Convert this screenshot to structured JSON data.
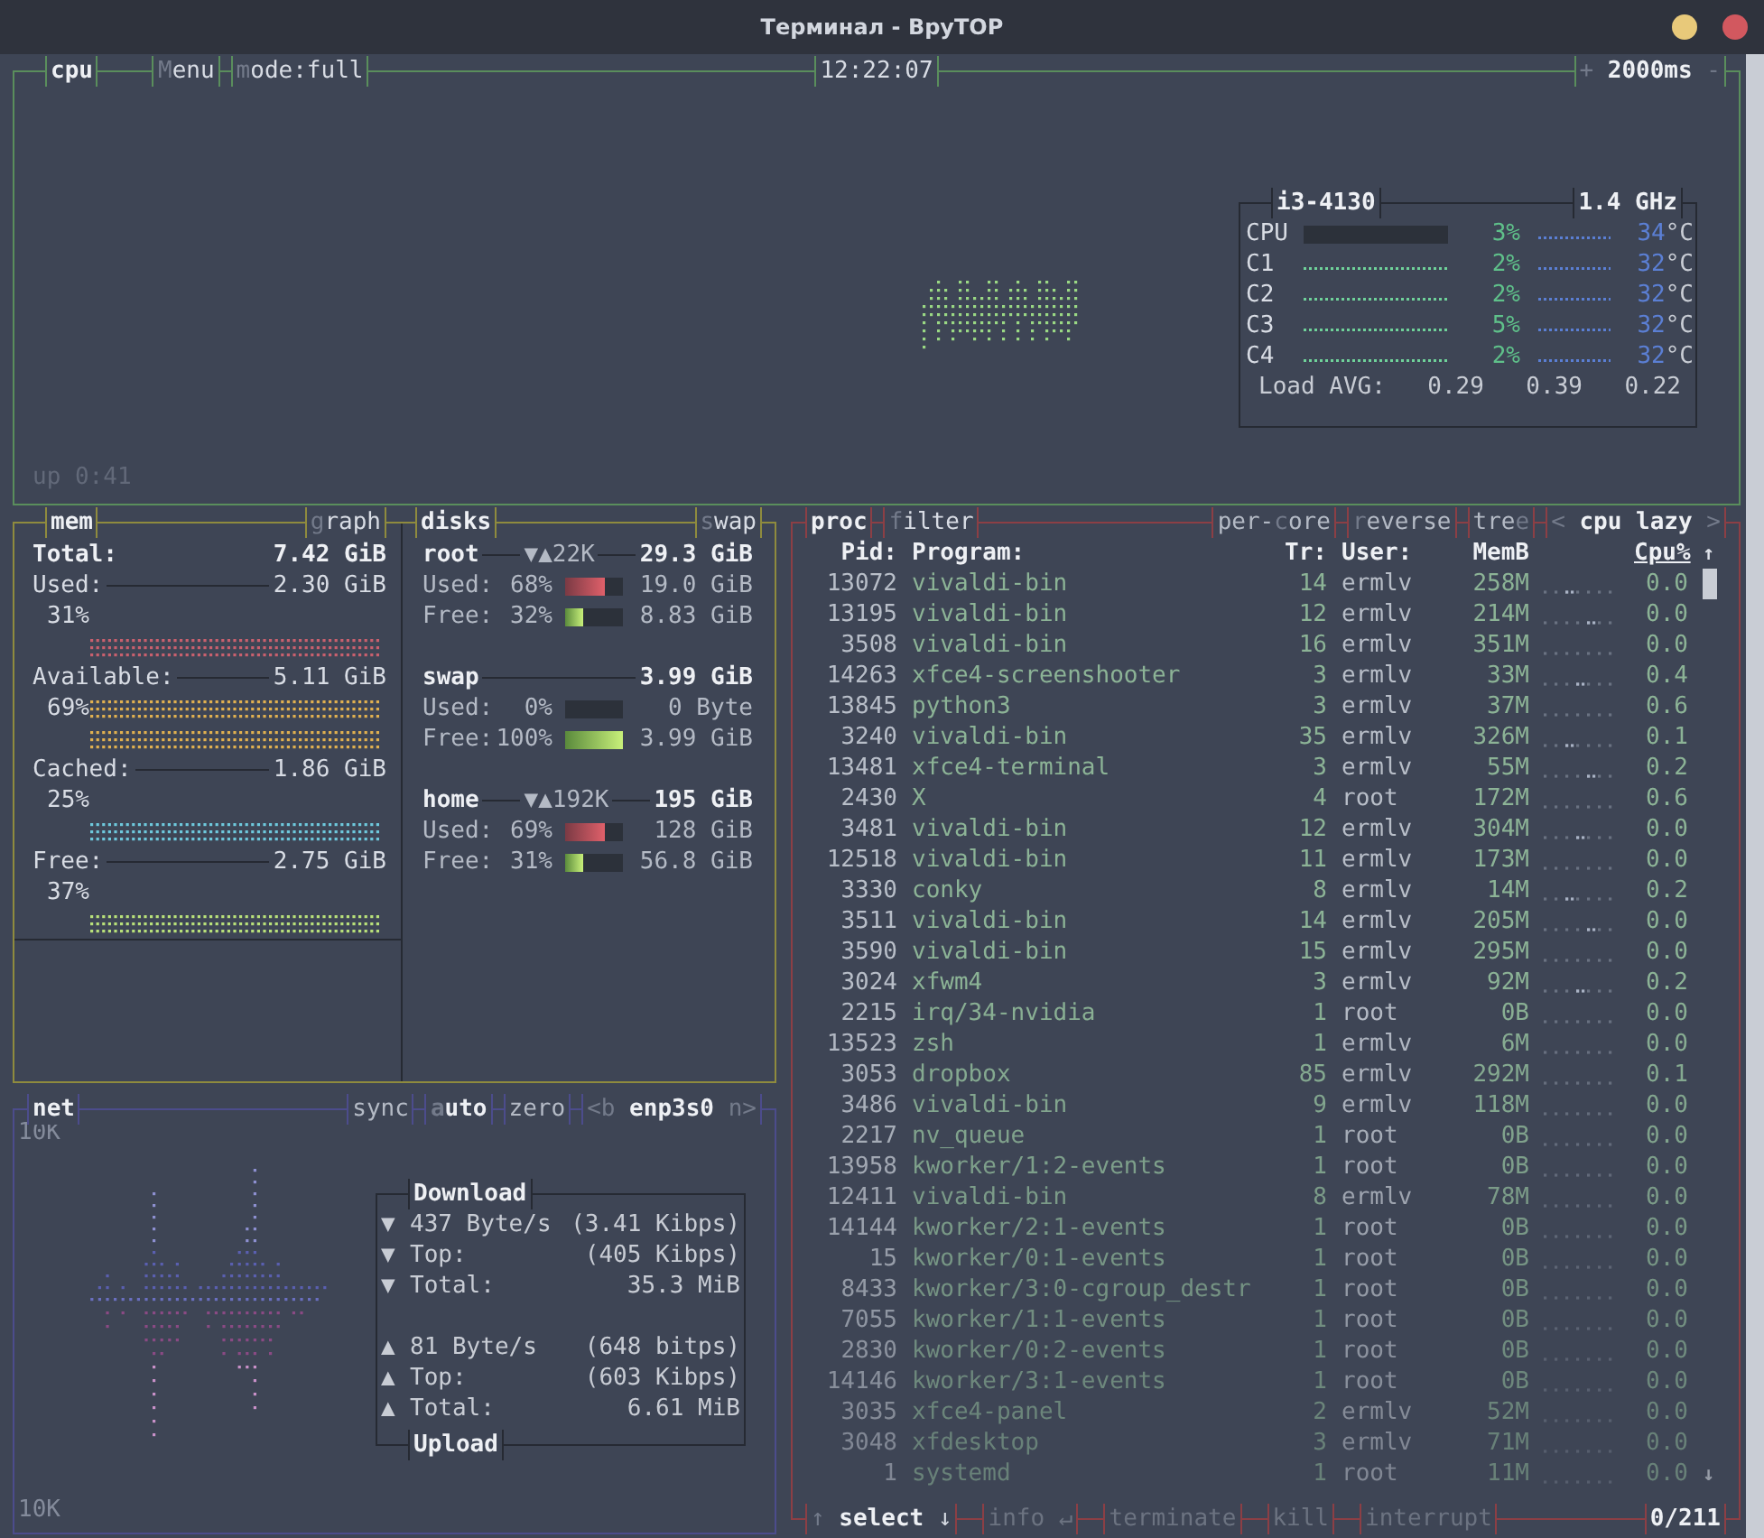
{
  "window": {
    "title": "Терминал - BpyTOP"
  },
  "cpu": {
    "title": "cpu",
    "menu": {
      "hotkey": "M",
      "text": "enu"
    },
    "mode": {
      "hotkey": "m",
      "text": "ode:full"
    },
    "clock": "12:22:07",
    "interval": {
      "plus": "+",
      "value": "2000ms",
      "minus": "-"
    },
    "uptime": "up 0:41",
    "info": {
      "model": "i3-4130",
      "frequency": "1.4 GHz",
      "cores": [
        {
          "kind": "total",
          "name": "CPU",
          "percent": "3%",
          "temp": "34",
          "unit": "°C"
        },
        {
          "kind": "core",
          "name": "C1",
          "percent": "2%",
          "temp": "32",
          "unit": "°C"
        },
        {
          "kind": "core",
          "name": "C2",
          "percent": "2%",
          "temp": "32",
          "unit": "°C"
        },
        {
          "kind": "core",
          "name": "C3",
          "percent": "5%",
          "temp": "32",
          "unit": "°C"
        },
        {
          "kind": "core",
          "name": "C4",
          "percent": "2%",
          "temp": "32",
          "unit": "°C"
        }
      ],
      "load_label": "Load AVG:",
      "load": [
        "0.29",
        "0.39",
        "0.22"
      ]
    }
  },
  "mem": {
    "title": "mem",
    "graph_toggle": {
      "hotkey": "g",
      "text": "raph"
    },
    "items": [
      {
        "kind": "total",
        "label": "Total:",
        "value": "7.42 GiB"
      },
      {
        "kind": "used",
        "label": "Used:",
        "value": "2.30 GiB",
        "percent": "31%",
        "color": "#c8606e"
      },
      {
        "kind": "available",
        "label": "Available:",
        "value": "5.11 GiB",
        "percent": "69%",
        "color": "#e0b050"
      },
      {
        "kind": "cached",
        "label": "Cached:",
        "value": "1.86 GiB",
        "percent": "25%",
        "color": "#6ec8dc"
      },
      {
        "kind": "free",
        "label": "Free:",
        "value": "2.75 GiB",
        "percent": "37%",
        "color": "#b8e07a"
      }
    ]
  },
  "disks": {
    "title": "disks",
    "swap_toggle": {
      "hotkey": "s",
      "text": "wap"
    },
    "entries": [
      {
        "name": "root",
        "io": "▼▲22K",
        "total": "29.3 GiB",
        "rows": [
          {
            "kind": "used",
            "label": "Used:",
            "percent": "68%",
            "level": 0.68,
            "value": "19.0 GiB"
          },
          {
            "kind": "free",
            "label": "Free:",
            "percent": "32%",
            "level": 0.32,
            "value": "8.83 GiB"
          }
        ]
      },
      {
        "name": "swap",
        "total": "3.99 GiB",
        "rows": [
          {
            "kind": "used",
            "label": "Used:",
            "percent": "0%",
            "level": 0,
            "value": "0 Byte"
          },
          {
            "kind": "free",
            "label": "Free:",
            "percent": "100%",
            "level": 1,
            "value": "3.99 GiB"
          }
        ]
      },
      {
        "name": "home",
        "io": "▼▲192K",
        "total": "195 GiB",
        "rows": [
          {
            "kind": "used",
            "label": "Used:",
            "percent": "69%",
            "level": 0.69,
            "value": "128 GiB"
          },
          {
            "kind": "free",
            "label": "Free:",
            "percent": "31%",
            "level": 0.31,
            "value": "56.8 GiB"
          }
        ]
      }
    ]
  },
  "net": {
    "title": "net",
    "toggles": [
      {
        "text": "sync",
        "on": false
      },
      {
        "hotkey": "a",
        "text": "uto",
        "on": true
      },
      {
        "text": "zero",
        "on": false
      }
    ],
    "interface": {
      "prev": "<b",
      "name": "enp3s0",
      "next": "n>"
    },
    "scale_top": "10K",
    "scale_bottom": "10K",
    "download": {
      "title": "Download",
      "rows": [
        {
          "label": "437 Byte/s",
          "value": "(3.41 Kibps)"
        },
        {
          "label": "Top:",
          "value": "(405 Kibps)"
        },
        {
          "label": "Total:",
          "value": "35.3 MiB"
        }
      ],
      "arrow": "▼"
    },
    "upload": {
      "title": "Upload",
      "rows": [
        {
          "label": "81 Byte/s",
          "value": "(648 bitps)"
        },
        {
          "label": "Top:",
          "value": "(603 Kibps)"
        },
        {
          "label": "Total:",
          "value": "6.61 MiB"
        }
      ],
      "arrow": "▲"
    }
  },
  "proc": {
    "title": "proc",
    "filter": {
      "hotkey": "f",
      "text": "ilter"
    },
    "toggles": [
      {
        "pre": "per-",
        "hotkey": "c",
        "text": "ore",
        "on": false
      },
      {
        "hotkey": "r",
        "text": "everse",
        "on": false
      },
      {
        "pre": "tre",
        "hotkey": "e",
        "on": false
      }
    ],
    "sorting": {
      "prev": "<",
      "value": "cpu lazy",
      "next": ">"
    },
    "columns": [
      {
        "label": "Pid:",
        "sorted": false
      },
      {
        "label": "Program:",
        "sorted": false
      },
      {
        "label": "Tr:",
        "sorted": false
      },
      {
        "label": "User:",
        "sorted": false
      },
      {
        "label": "MemB",
        "sorted": false
      },
      {
        "label": "Cpu%",
        "sorted": true
      }
    ],
    "scroll_up": "↑",
    "scroll_down": "↓",
    "rows": [
      {
        "pid": "13072",
        "program": "vivaldi-bin",
        "threads": "14",
        "user": "ermlv",
        "mem": "258M",
        "cpu": "0.0"
      },
      {
        "pid": "13195",
        "program": "vivaldi-bin",
        "threads": "12",
        "user": "ermlv",
        "mem": "214M",
        "cpu": "0.0"
      },
      {
        "pid": "3508",
        "program": "vivaldi-bin",
        "threads": "16",
        "user": "ermlv",
        "mem": "351M",
        "cpu": "0.0"
      },
      {
        "pid": "14263",
        "program": "xfce4-screenshooter",
        "threads": "3",
        "user": "ermlv",
        "mem": "33M",
        "cpu": "0.4"
      },
      {
        "pid": "13845",
        "program": "python3",
        "threads": "3",
        "user": "ermlv",
        "mem": "37M",
        "cpu": "0.6"
      },
      {
        "pid": "3240",
        "program": "vivaldi-bin",
        "threads": "35",
        "user": "ermlv",
        "mem": "326M",
        "cpu": "0.1"
      },
      {
        "pid": "13481",
        "program": "xfce4-terminal",
        "threads": "3",
        "user": "ermlv",
        "mem": "55M",
        "cpu": "0.2"
      },
      {
        "pid": "2430",
        "program": "X",
        "threads": "4",
        "user": "root",
        "mem": "172M",
        "cpu": "0.6"
      },
      {
        "pid": "3481",
        "program": "vivaldi-bin",
        "threads": "12",
        "user": "ermlv",
        "mem": "304M",
        "cpu": "0.0"
      },
      {
        "pid": "12518",
        "program": "vivaldi-bin",
        "threads": "11",
        "user": "ermlv",
        "mem": "173M",
        "cpu": "0.0"
      },
      {
        "pid": "3330",
        "program": "conky",
        "threads": "8",
        "user": "ermlv",
        "mem": "14M",
        "cpu": "0.2"
      },
      {
        "pid": "3511",
        "program": "vivaldi-bin",
        "threads": "14",
        "user": "ermlv",
        "mem": "205M",
        "cpu": "0.0"
      },
      {
        "pid": "3590",
        "program": "vivaldi-bin",
        "threads": "15",
        "user": "ermlv",
        "mem": "295M",
        "cpu": "0.0"
      },
      {
        "pid": "3024",
        "program": "xfwm4",
        "threads": "3",
        "user": "ermlv",
        "mem": "92M",
        "cpu": "0.2"
      },
      {
        "pid": "2215",
        "program": "irq/34-nvidia",
        "threads": "1",
        "user": "root",
        "mem": "0B",
        "cpu": "0.0"
      },
      {
        "pid": "13523",
        "program": "zsh",
        "threads": "1",
        "user": "ermlv",
        "mem": "6M",
        "cpu": "0.0"
      },
      {
        "pid": "3053",
        "program": "dropbox",
        "threads": "85",
        "user": "ermlv",
        "mem": "292M",
        "cpu": "0.1"
      },
      {
        "pid": "3486",
        "program": "vivaldi-bin",
        "threads": "9",
        "user": "ermlv",
        "mem": "118M",
        "cpu": "0.0"
      },
      {
        "pid": "2217",
        "program": "nv_queue",
        "threads": "1",
        "user": "root",
        "mem": "0B",
        "cpu": "0.0"
      },
      {
        "pid": "13958",
        "program": "kworker/1:2-events",
        "threads": "1",
        "user": "root",
        "mem": "0B",
        "cpu": "0.0"
      },
      {
        "pid": "12411",
        "program": "vivaldi-bin",
        "threads": "8",
        "user": "ermlv",
        "mem": "78M",
        "cpu": "0.0"
      },
      {
        "pid": "14144",
        "program": "kworker/2:1-events",
        "threads": "1",
        "user": "root",
        "mem": "0B",
        "cpu": "0.0"
      },
      {
        "pid": "15",
        "program": "kworker/0:1-events",
        "threads": "1",
        "user": "root",
        "mem": "0B",
        "cpu": "0.0"
      },
      {
        "pid": "8433",
        "program": "kworker/3:0-cgroup_destr",
        "threads": "1",
        "user": "root",
        "mem": "0B",
        "cpu": "0.0"
      },
      {
        "pid": "7055",
        "program": "kworker/1:1-events",
        "threads": "1",
        "user": "root",
        "mem": "0B",
        "cpu": "0.0"
      },
      {
        "pid": "2830",
        "program": "kworker/0:2-events",
        "threads": "1",
        "user": "root",
        "mem": "0B",
        "cpu": "0.0"
      },
      {
        "pid": "14146",
        "program": "kworker/3:1-events",
        "threads": "1",
        "user": "root",
        "mem": "0B",
        "cpu": "0.0"
      },
      {
        "pid": "3035",
        "program": "xfce4-panel",
        "threads": "2",
        "user": "ermlv",
        "mem": "52M",
        "cpu": "0.0"
      },
      {
        "pid": "3048",
        "program": "xfdesktop",
        "threads": "3",
        "user": "ermlv",
        "mem": "71M",
        "cpu": "0.0"
      },
      {
        "pid": "1",
        "program": "systemd",
        "threads": "1",
        "user": "root",
        "mem": "11M",
        "cpu": "0.0"
      }
    ],
    "footer": {
      "select": {
        "pre": "↑",
        "label": "select",
        "post": "↓"
      },
      "actions": [
        {
          "label": "info",
          "suffix": "↵",
          "disabled": true
        },
        {
          "label": "terminate",
          "disabled": true
        },
        {
          "label": "kill",
          "disabled": true
        },
        {
          "label": "interrupt",
          "disabled": true
        }
      ],
      "count": "0/211"
    }
  }
}
